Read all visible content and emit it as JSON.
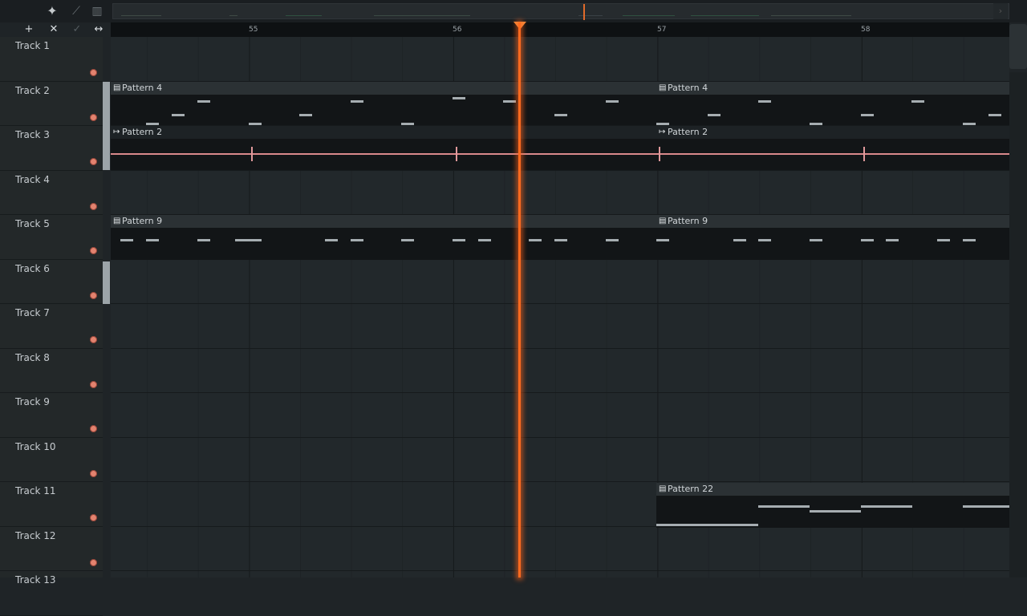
{
  "toolbar": {
    "icons": [
      "waveform-snap-icon",
      "link-icon",
      "piano-icon"
    ],
    "row2_icons": [
      "add-icon",
      "delete-icon",
      "check-icon",
      "resize-icon"
    ],
    "glyphs": {
      "add": "+",
      "delete": "✕",
      "check": "✓",
      "resize": "↔",
      "snap": "✦",
      "link": "⟋",
      "piano": "▥",
      "arrow_l": "‹",
      "arrow_r": "›"
    }
  },
  "ruler": {
    "bars": [
      "55",
      "56",
      "57",
      "58"
    ]
  },
  "colors": {
    "playhead": "#ff6a1e",
    "background": "#22282b",
    "clip_body": "#121517",
    "audio_wave": "#d9898b",
    "mute_dot": "#e3836f"
  },
  "tracks": [
    {
      "name": "Track 1"
    },
    {
      "name": "Track 2"
    },
    {
      "name": "Track 3"
    },
    {
      "name": "Track 4"
    },
    {
      "name": "Track 5"
    },
    {
      "name": "Track 6"
    },
    {
      "name": "Track 7"
    },
    {
      "name": "Track 8"
    },
    {
      "name": "Track 9"
    },
    {
      "name": "Track 10"
    },
    {
      "name": "Track 11"
    },
    {
      "name": "Track 12"
    },
    {
      "name": "Track 13"
    }
  ],
  "clips": {
    "pattern4": "Pattern 4",
    "pattern2": "Pattern 2",
    "pattern9": "Pattern 9",
    "pattern22": "Pattern 22"
  }
}
